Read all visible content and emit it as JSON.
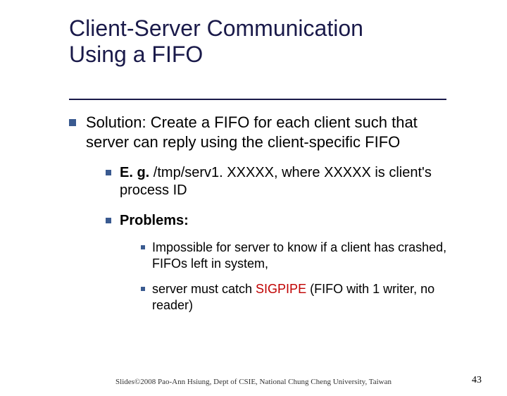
{
  "title": {
    "line1": "Client-Server Communication",
    "line2": "Using a FIFO"
  },
  "body": {
    "solution": "Solution: Create a FIFO for each client such that server can reply using the client-specific FIFO",
    "example": {
      "label": "E. g. ",
      "text": "/tmp/serv1. XXXXX, where XXXXX is client's process ID"
    },
    "problems": {
      "label": "Problems:",
      "items": [
        "Impossible for server to know if a client has crashed, FIFOs left in system,"
      ],
      "item2": {
        "pre": "server must catch ",
        "sigpipe": "SIGPIPE",
        "post": " (FIFO with 1 writer, no reader)"
      }
    }
  },
  "footer": {
    "text": "Slides©2008 Pao-Ann Hsiung, Dept of CSIE, National Chung Cheng University, Taiwan",
    "page": "43"
  }
}
